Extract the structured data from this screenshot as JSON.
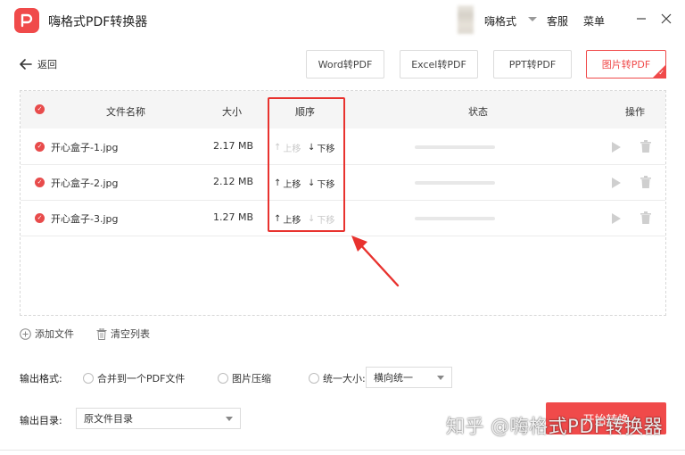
{
  "app": {
    "title": "嗨格式PDF转换器"
  },
  "header": {
    "user_name": "嗨格式",
    "service_label": "客服",
    "menu_label": "菜单"
  },
  "nav": {
    "back_label": "返回",
    "tabs": [
      {
        "label": "Word转PDF",
        "active": false
      },
      {
        "label": "Excel转PDF",
        "active": false
      },
      {
        "label": "PPT转PDF",
        "active": false
      },
      {
        "label": "图片转PDF",
        "active": true
      }
    ]
  },
  "table": {
    "headers": {
      "name": "文件名称",
      "size": "大小",
      "order": "顺序",
      "status": "状态",
      "actions": "操作"
    },
    "rows": [
      {
        "name": "开心盒子-1.jpg",
        "size": "2.17 MB",
        "up_label": "上移",
        "down_label": "下移",
        "up_enabled": false,
        "down_enabled": true
      },
      {
        "name": "开心盒子-2.jpg",
        "size": "2.12 MB",
        "up_label": "上移",
        "down_label": "下移",
        "up_enabled": true,
        "down_enabled": true
      },
      {
        "name": "开心盒子-3.jpg",
        "size": "1.27 MB",
        "up_label": "上移",
        "down_label": "下移",
        "up_enabled": true,
        "down_enabled": false
      }
    ]
  },
  "actions": {
    "add_file": "添加文件",
    "clear_list": "清空列表"
  },
  "output": {
    "format_label": "输出格式:",
    "option_merge": "合并到一个PDF文件",
    "option_compress": "图片压缩",
    "option_unify": "统一大小:",
    "unify_select_value": "横向统一",
    "dir_label": "输出目录:",
    "dir_select_value": "原文件目录"
  },
  "start_button": "开始转换",
  "watermark": "知乎 @嗨格式PDF转换器",
  "colors": {
    "accent": "#f04a4a",
    "highlight": "#e8322e"
  }
}
